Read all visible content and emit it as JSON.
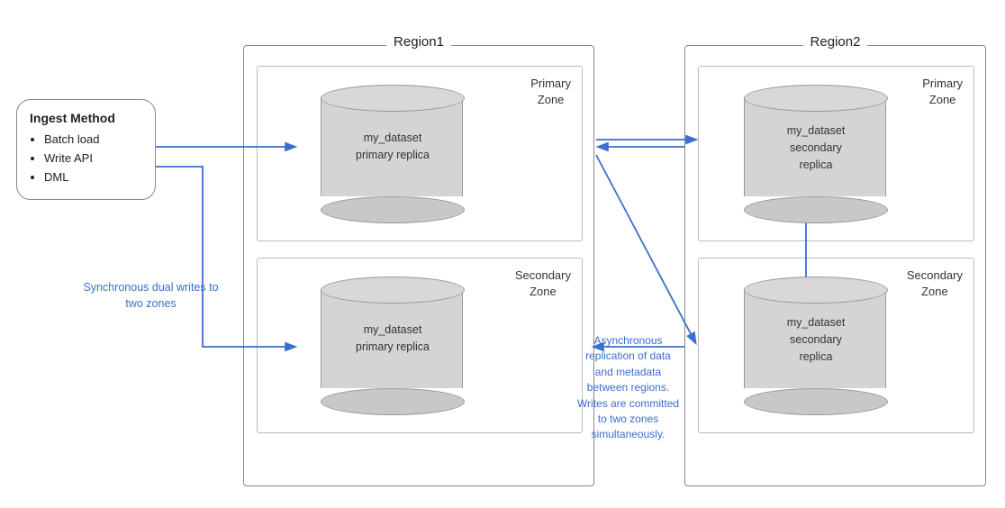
{
  "ingest": {
    "title": "Ingest Method",
    "items": [
      "Batch load",
      "Write API",
      "DML"
    ]
  },
  "region1": {
    "label": "Region1",
    "primaryZone": {
      "label": "Primary\nZone",
      "cylinder": {
        "line1": "my_dataset",
        "line2": "primary replica"
      }
    },
    "secondaryZone": {
      "label": "Secondary\nZone",
      "cylinder": {
        "line1": "my_dataset",
        "line2": "primary replica"
      }
    }
  },
  "region2": {
    "label": "Region2",
    "primaryZone": {
      "label": "Primary\nZone",
      "cylinder": {
        "line1": "my_dataset",
        "line2": "secondary",
        "line3": "replica"
      }
    },
    "secondaryZone": {
      "label": "Secondary\nZone",
      "cylinder": {
        "line1": "my_dataset",
        "line2": "secondary",
        "line3": "replica"
      }
    }
  },
  "annotations": {
    "sync": "Synchronous dual writes\nto two zones",
    "async": "Asynchronous\nreplication of data\nand metadata\nbetween regions.\nWrites are committed\nto two zones\nsimultaneously."
  }
}
